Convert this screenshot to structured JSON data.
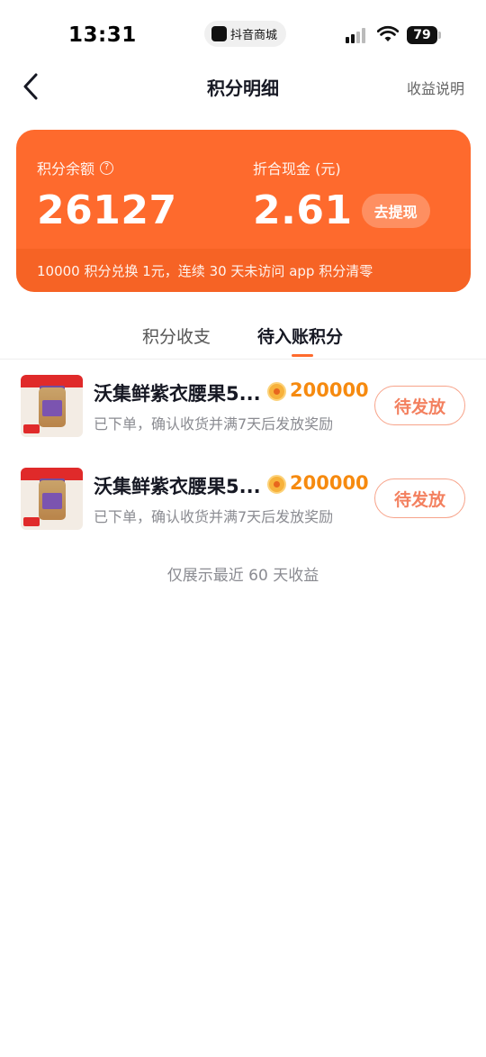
{
  "status_bar": {
    "time": "13:31",
    "app_pill_label": "抖音商城",
    "battery_level": "79",
    "icons": [
      "signal-icon",
      "wifi-icon",
      "battery-icon"
    ]
  },
  "nav": {
    "title": "积分明细",
    "right_link": "收益说明",
    "back_icon": "chevron-left-icon"
  },
  "card": {
    "balance_label": "积分余额",
    "balance_value": "26127",
    "cash_label": "折合现金 (元)",
    "cash_value": "2.61",
    "withdraw_label": "去提现",
    "notice": "10000 积分兑换 1元，连续 30 天未访问 app 积分清零",
    "help_icon": "?",
    "bg_color": "#fe6a2d"
  },
  "tabs": [
    {
      "label": "积分收支",
      "active": false
    },
    {
      "label": "待入账积分",
      "active": true
    }
  ],
  "orders": [
    {
      "title": "沃集鲜紫衣腰果5...",
      "points": "200000",
      "status_desc": "已下单，确认收货并满7天后发放奖励",
      "action_label": "待发放"
    },
    {
      "title": "沃集鲜紫衣腰果5...",
      "points": "200000",
      "status_desc": "已下单，确认收货并满7天后发放奖励",
      "action_label": "待发放"
    }
  ],
  "footer_note": "仅展示最近 60 天收益",
  "colors": {
    "accent": "#fe6a2d",
    "points_text": "#f68a0f",
    "pending_border": "#f7a38a"
  }
}
